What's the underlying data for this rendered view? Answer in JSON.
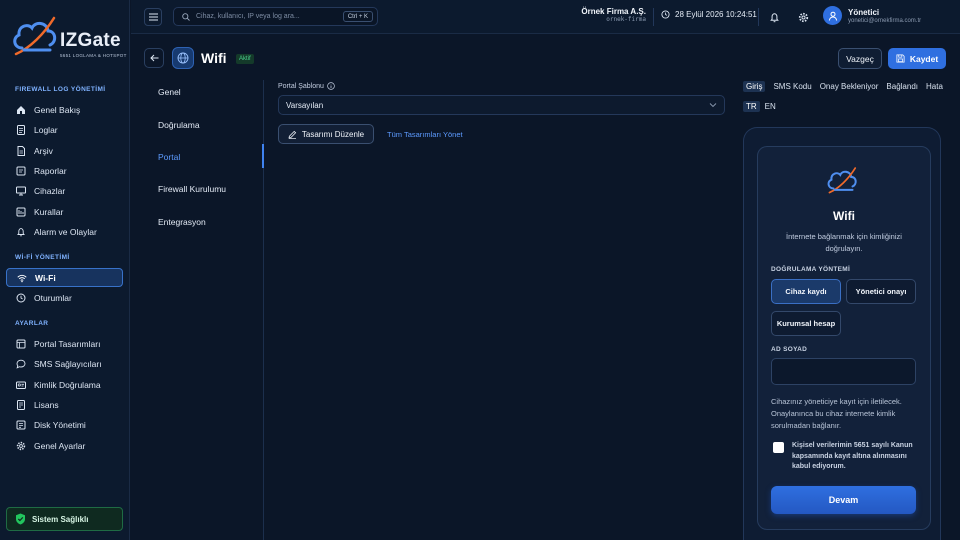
{
  "brand": {
    "name": "IZGate",
    "tagline": "5651 LOGLAMA & HOTSPOT",
    "accent": "#2f6fe0"
  },
  "sidebar": {
    "sections": [
      {
        "title": "FIREWALL LOG YÖNETİMİ",
        "items": [
          {
            "label": "Genel Bakış",
            "icon": "home-icon"
          },
          {
            "label": "Loglar",
            "icon": "log-icon"
          },
          {
            "label": "Arşiv",
            "icon": "archive-icon"
          },
          {
            "label": "Raporlar",
            "icon": "report-icon"
          },
          {
            "label": "Cihazlar",
            "icon": "monitor-icon"
          },
          {
            "label": "Kurallar",
            "icon": "rules-icon"
          },
          {
            "label": "Alarm ve Olaylar",
            "icon": "bell-icon"
          }
        ]
      },
      {
        "title": "Wİ-Fİ YÖNETİMİ",
        "items": [
          {
            "label": "Wi-Fi",
            "icon": "wifi-icon",
            "active": true
          },
          {
            "label": "Oturumlar",
            "icon": "clock-icon"
          }
        ]
      },
      {
        "title": "AYARLAR",
        "items": [
          {
            "label": "Portal Tasarımları",
            "icon": "layout-icon"
          },
          {
            "label": "SMS Sağlayıcıları",
            "icon": "chat-icon"
          },
          {
            "label": "Kimlik Doğrulama",
            "icon": "id-card-icon"
          },
          {
            "label": "Lisans",
            "icon": "license-icon"
          },
          {
            "label": "Disk Yönetimi",
            "icon": "disk-icon"
          },
          {
            "label": "Genel Ayarlar",
            "icon": "gear-icon"
          }
        ]
      }
    ],
    "health": {
      "label": "Sistem Sağlıklı",
      "color": "#22c55e"
    }
  },
  "topbar": {
    "search": {
      "placeholder": "Cihaz, kullanıcı, IP veya log ara...",
      "shortcut": "Ctrl + K"
    },
    "company": {
      "name": "Örnek Firma A.Ş.",
      "code": "ornek-firma"
    },
    "datetime": "28 Eylül 2026 10:24:51",
    "user": {
      "name": "Yönetici",
      "email": "yonetici@ornekfirma.com.tr"
    }
  },
  "page": {
    "title": "Wifi",
    "status": "Aktif",
    "cancel_label": "Vazgeç",
    "save_label": "Kaydet"
  },
  "subnav": {
    "items": [
      {
        "label": "Genel"
      },
      {
        "label": "Doğrulama"
      },
      {
        "label": "Portal",
        "active": true
      },
      {
        "label": "Firewall Kurulumu"
      },
      {
        "label": "Entegrasyon"
      }
    ]
  },
  "portal": {
    "template_label": "Portal Şablonu",
    "template_value": "Varsayılan",
    "edit_button": "Tasarımı Düzenle",
    "manage_link": "Tüm Tasarımları Yönet"
  },
  "preview": {
    "tabs": [
      "Giriş",
      "SMS Kodu",
      "Onay Bekleniyor",
      "Bağlandı",
      "Hata"
    ],
    "active_tab": "Giriş",
    "languages": [
      "TR",
      "EN"
    ],
    "active_language": "TR",
    "card": {
      "title": "Wifi",
      "description": "İnternete bağlanmak için kimliğinizi doğrulayın.",
      "method_label": "DOĞRULAMA YÖNTEMİ",
      "methods": [
        "Cihaz kaydı",
        "Yönetici onayı",
        "Kurumsal hesap"
      ],
      "selected_method": "Cihaz kaydı",
      "name_label": "AD SOYAD",
      "name_value": "",
      "note": "Cihazınız yöneticiye kayıt için iletilecek. Onaylanınca bu cihaz internete kimlik sorulmadan bağlanır.",
      "consent": "Kişisel verilerimin 5651 sayılı Kanun kapsamında kayıt altına alınmasını kabul ediyorum.",
      "submit": "Devam"
    }
  }
}
